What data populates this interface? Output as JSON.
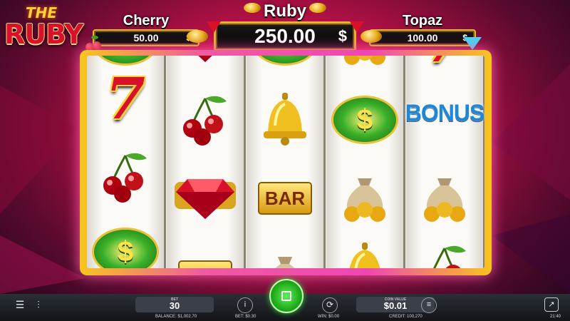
{
  "logo": {
    "line1": "THE",
    "line2": "RUBY"
  },
  "jackpots": {
    "cherry": {
      "name": "Cherry",
      "value": "50.00",
      "currency": "$"
    },
    "ruby": {
      "name": "Ruby",
      "value": "250.00",
      "currency": "$"
    },
    "topaz": {
      "name": "Topaz",
      "value": "100.00",
      "currency": "$"
    }
  },
  "reels": [
    [
      "dollar",
      "seven",
      "cherry",
      "dollar"
    ],
    [
      "ruby",
      "cherry",
      "ruby",
      "bar"
    ],
    [
      "dollar",
      "bell",
      "bar",
      "moneybag"
    ],
    [
      "moneybag",
      "dollar",
      "moneybag",
      "bell"
    ],
    [
      "seven",
      "bonus",
      "moneybag",
      "cherry"
    ]
  ],
  "symbols": {
    "seven": "7",
    "bar": "BAR",
    "dollar": "$",
    "bonus": "BONUS"
  },
  "bottom_bar": {
    "bet_label": "BET",
    "bet_value": "30",
    "coin_label": "COIN VALUE",
    "coin_value": "$0.01",
    "balance_label": "BALANCE:",
    "balance_value": "$1,002.70",
    "bet_info_label": "BET:",
    "bet_info_value": "$0.30",
    "win_label": "WIN:",
    "win_value": "$0.00",
    "credit_label": "CREDIT:",
    "credit_value": "100,270",
    "time": "21:40"
  },
  "icons": {
    "menu": "menu-icon",
    "settings": "sliders-icon",
    "info": "info-icon",
    "spin": "stop-icon",
    "autoplay": "autoplay-icon",
    "coins": "coin-stack-icon",
    "fullscreen": "fullscreen-icon"
  },
  "colors": {
    "ruby_red": "#d8102a",
    "gold": "#f7c51d",
    "spin_green": "#17a012",
    "frame_pink": "#f046b3"
  }
}
